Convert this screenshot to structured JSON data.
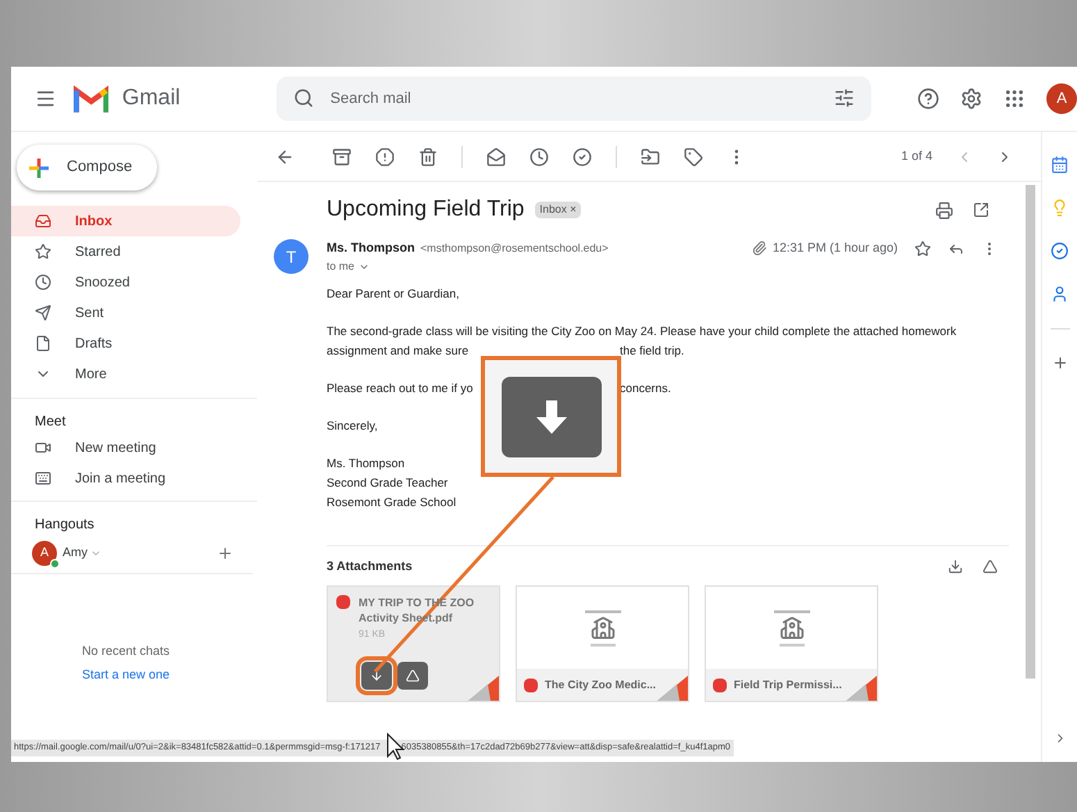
{
  "header": {
    "app_name": "Gmail",
    "search": {
      "placeholder": "Search mail"
    },
    "avatar": "A"
  },
  "compose": "Compose",
  "nav": [
    {
      "label": "Inbox",
      "selected": true
    },
    {
      "label": "Starred",
      "selected": false
    },
    {
      "label": "Snoozed",
      "selected": false
    },
    {
      "label": "Sent",
      "selected": false
    },
    {
      "label": "Drafts",
      "selected": false
    },
    {
      "label": "More",
      "selected": false
    }
  ],
  "meet": {
    "title": "Meet",
    "items": [
      {
        "label": "New meeting"
      },
      {
        "label": "Join a meeting"
      }
    ]
  },
  "hangouts": {
    "title": "Hangouts",
    "user": {
      "initial": "A",
      "name": "Amy",
      "online": true
    },
    "empty": "No recent chats",
    "link": "Start a new one"
  },
  "toolbar": {
    "count": "1 of 4"
  },
  "email": {
    "subject": "Upcoming Field Trip",
    "label": "Inbox",
    "label_close": "×",
    "sender_initial": "T",
    "sender": "Ms. Thompson",
    "address": "<msthompson@rosementschool.edu>",
    "recipient": "to me",
    "time": "12:31 PM (1 hour ago)",
    "paragraphs": [
      [
        [
          "Dear Parent or Guardian,"
        ]
      ],
      [
        [
          "The second-grade class will be visiting the City Zoo on May 24. Please have your child complete the attached homework"
        ],
        [
          "assignment and make sure",
          "the field trip."
        ]
      ],
      [
        [
          "Please reach out to me if yo",
          "concerns."
        ]
      ],
      [
        [
          "Sincerely,"
        ]
      ],
      [
        [
          "Ms. Thompson"
        ],
        [
          "Second Grade Teacher"
        ],
        [
          "Rosemont Grade School"
        ]
      ]
    ],
    "attachments_title": "3 Attachments",
    "attachments": [
      {
        "kind": "hover",
        "name": "MY TRIP TO THE ZOO Activity Sheet.pdf",
        "size": "91 KB",
        "highlighted": true
      },
      {
        "kind": "preview",
        "name": "The City Zoo Medic..."
      },
      {
        "kind": "preview",
        "name": "Field Trip Permissi..."
      }
    ]
  },
  "status_bar": {
    "url_start": "https://mail.google.com/mail/u/0?ui=2&ik=83481fc582&attid=0.1&permmsgid=msg-f:171217",
    "url_end": "6035380855&th=17c2dad72b69b277&view=att&disp=safe&realattid=f_ku4f1apm0"
  }
}
